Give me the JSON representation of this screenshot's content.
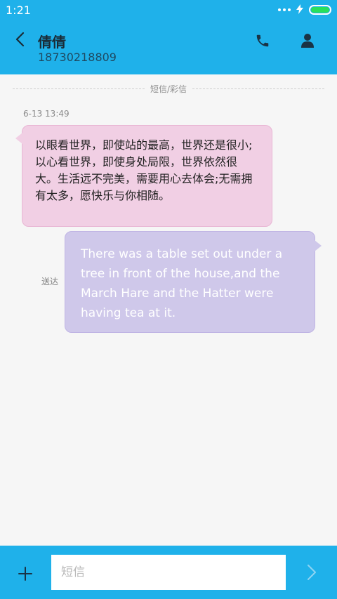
{
  "status_bar": {
    "time": "1:21",
    "icons": [
      "more-dots-icon",
      "charging-icon",
      "battery-icon"
    ],
    "battery_color": "#28e05c"
  },
  "header": {
    "title": "倩倩",
    "subtitle": "18730218809",
    "background": "#1fb1ea"
  },
  "conversation": {
    "divider_label": "短信/彩信",
    "timestamp": "6-13 13:49",
    "incoming": {
      "text": "以眼看世界，即使站的最高，世界还是很小;以心看世界，即使身处局限，世界依然很大。生活远不完美，需要用心去体会;无需拥有太多，愿快乐与你相随。",
      "bubble_color": "#f1cfe4"
    },
    "outgoing": {
      "status": "送达",
      "text": "There was a table set out under a tree in front of the house,and the March Hare and the Hatter were having tea at it.",
      "bubble_color": "#cfc8ea"
    }
  },
  "compose": {
    "placeholder": "短信",
    "value": ""
  }
}
